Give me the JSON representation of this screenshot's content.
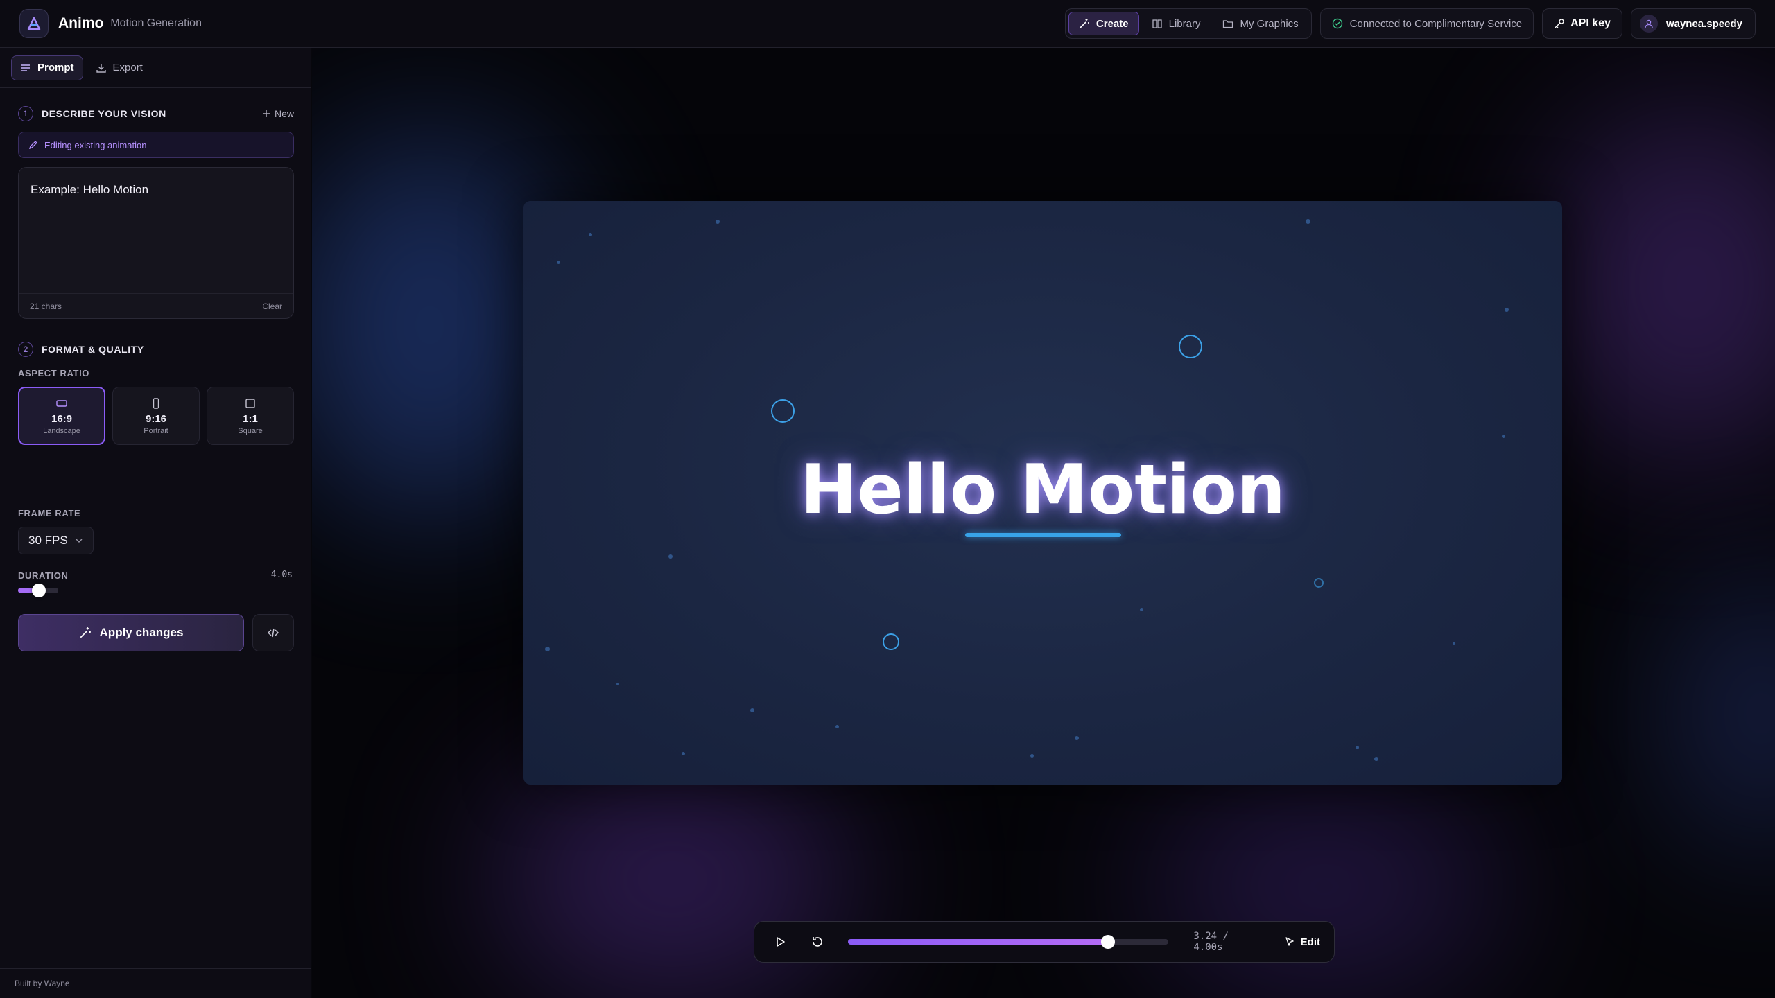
{
  "header": {
    "brand": "Animo",
    "subtitle": "Motion Generation",
    "nav": [
      {
        "label": "Create",
        "icon": "wand-icon",
        "active": true
      },
      {
        "label": "Library",
        "icon": "book-icon",
        "active": false
      },
      {
        "label": "My Graphics",
        "icon": "folder-icon",
        "active": false
      }
    ],
    "status": "Connected to Complimentary Service",
    "api_key": "API key",
    "user": "waynea.speedy"
  },
  "sidebar": {
    "tabs": [
      {
        "label": "Prompt",
        "icon": "list-icon",
        "active": true
      },
      {
        "label": "Export",
        "icon": "download-icon",
        "active": false
      }
    ],
    "section1": {
      "step": "1",
      "title": "DESCRIBE YOUR VISION",
      "new_label": "New"
    },
    "edit_banner": "Editing existing animation",
    "prompt": {
      "text": "Example: Hello Motion",
      "chars": "21 chars",
      "clear": "Clear"
    },
    "section2": {
      "step": "2",
      "title": "FORMAT & QUALITY"
    },
    "aspect_label": "ASPECT RATIO",
    "aspects": [
      {
        "ratio": "16:9",
        "name": "Landscape",
        "selected": true
      },
      {
        "ratio": "9:16",
        "name": "Portrait",
        "selected": false
      },
      {
        "ratio": "1:1",
        "name": "Square",
        "selected": false
      }
    ],
    "frame_rate_label": "FRAME RATE",
    "frame_rate": "30 FPS",
    "duration_label": "DURATION",
    "duration_value": "4.0s",
    "duration_fraction": 0.52,
    "apply_label": "Apply changes",
    "footer": "Built by Wayne"
  },
  "stage": {
    "headline": "Hello Motion",
    "player": {
      "time": "3.24 / 4.00s",
      "progress": 0.81,
      "edit_label": "Edit"
    }
  },
  "colors": {
    "accent": "#8b5cf6",
    "accent_light": "#b691ff",
    "ring": "#3ca0e6",
    "success": "#3ecf8e"
  }
}
